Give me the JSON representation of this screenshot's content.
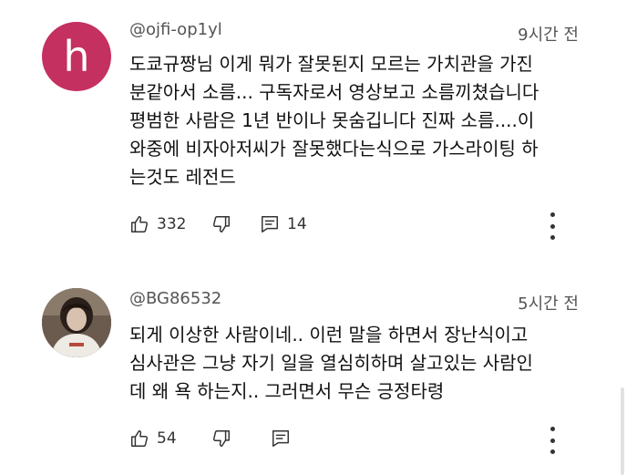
{
  "comments": [
    {
      "avatar_letter": "h",
      "avatar_color": "#c4305f",
      "username": "@ojfi-op1yl",
      "timestamp": "9시간 전",
      "lines": [
        "도쿄규짱님 이게 뭐가 잘못된지 모르는 가치관을 가진",
        "분같아서 소름... 구독자로서 영상보고 소름끼쳤습니다",
        "평범한 사람은 1년 반이나 못숨깁니다 진짜 소름....이",
        "와중에 비자아저씨가 잘못했다는식으로 가스라이팅 하",
        "는것도 레전드"
      ],
      "likes": "332",
      "replies": "14"
    },
    {
      "avatar_color": "#5a4a40",
      "username": "@BG86532",
      "timestamp": "5시간 전",
      "lines": [
        "되게 이상한 사람이네.. 이런 말을 하면서 장난식이고",
        "심사관은 그냥 자기 일을 열심히하며 살고있는 사람인",
        "데 왜 욕 하는지.. 그러면서 무슨 긍정타령"
      ],
      "likes": "54"
    }
  ],
  "icons": {
    "like": "thumbs-up-icon",
    "dislike": "thumbs-down-icon",
    "reply": "reply-icon",
    "more": "more-vert-icon"
  }
}
